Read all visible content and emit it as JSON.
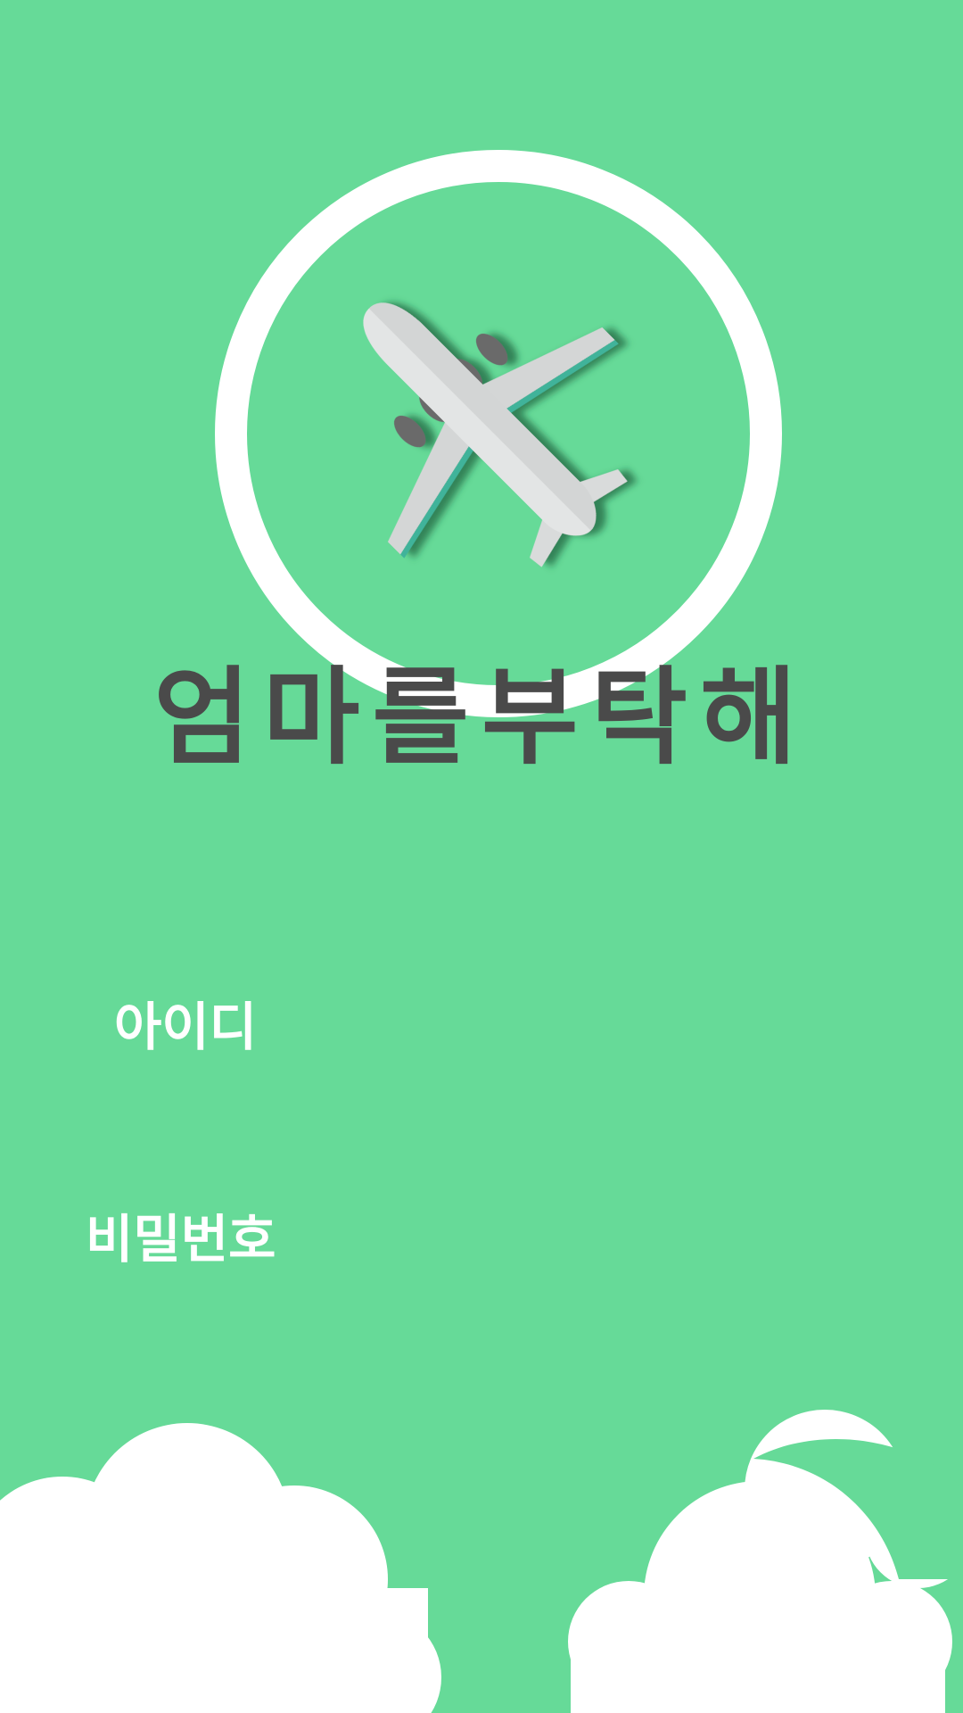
{
  "app": {
    "title": "엄마를부탁해"
  },
  "login": {
    "id_label": "아이디",
    "id_value": "",
    "password_label": "비밀번호",
    "password_value": ""
  },
  "colors": {
    "background": "#66da98",
    "title_text": "#4a4a4a",
    "label_text": "#ffffff",
    "ring": "#ffffff",
    "cloud": "#ffffff"
  },
  "icons": {
    "logo": "airplane-icon"
  }
}
